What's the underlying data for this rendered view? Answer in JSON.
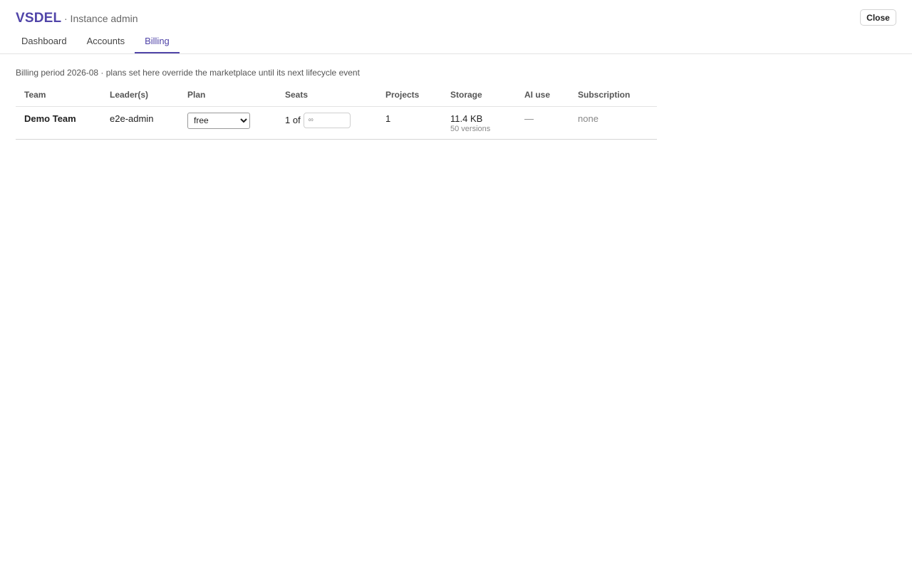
{
  "header": {
    "brand": "VSDEL",
    "subtitle": "· Instance admin",
    "close_label": "Close"
  },
  "tabs": [
    {
      "label": "Dashboard",
      "active": false
    },
    {
      "label": "Accounts",
      "active": false
    },
    {
      "label": "Billing",
      "active": true
    }
  ],
  "billing": {
    "period_text": "Billing period 2026-08 · plans set here override the marketplace until its next lifecycle event",
    "columns": [
      "Team",
      "Leader(s)",
      "Plan",
      "Seats",
      "Projects",
      "Storage",
      "AI use",
      "Subscription"
    ],
    "rows": [
      {
        "team": "Demo Team",
        "leaders": "e2e-admin",
        "plan": "free",
        "seats_used": "1 of",
        "seats_placeholder": "∞",
        "projects": "1",
        "storage": "11.4 KB",
        "storage_sub": "50 versions",
        "ai_use": "—",
        "subscription": "none"
      }
    ]
  },
  "colors": {
    "accent": "#5044a8",
    "muted_text": "#888888",
    "border": "#e3e3e3"
  }
}
